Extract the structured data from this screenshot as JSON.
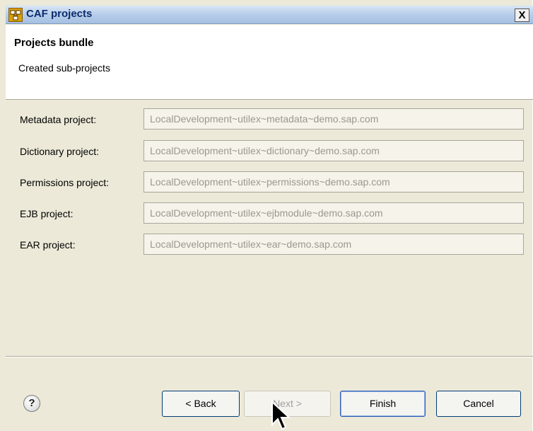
{
  "window": {
    "title": "CAF projects",
    "close_label": "X"
  },
  "banner": {
    "title": "Projects bundle",
    "description": "Created sub-projects"
  },
  "fields": [
    {
      "label": "Metadata project:",
      "value": "LocalDevelopment~utilex~metadata~demo.sap.com"
    },
    {
      "label": "Dictionary project:",
      "value": "LocalDevelopment~utilex~dictionary~demo.sap.com"
    },
    {
      "label": "Permissions project:",
      "value": "LocalDevelopment~utilex~permissions~demo.sap.com"
    },
    {
      "label": "EJB project:",
      "value": "LocalDevelopment~utilex~ejbmodule~demo.sap.com"
    },
    {
      "label": "EAR project:",
      "value": "LocalDevelopment~utilex~ear~demo.sap.com"
    }
  ],
  "buttons": {
    "help": "?",
    "back": "< Back",
    "next": "Next >",
    "finish": "Finish",
    "cancel": "Cancel"
  },
  "icons": {
    "app": "caf-project-icon",
    "help": "help-icon",
    "cursor": "mouse-pointer-icon"
  }
}
